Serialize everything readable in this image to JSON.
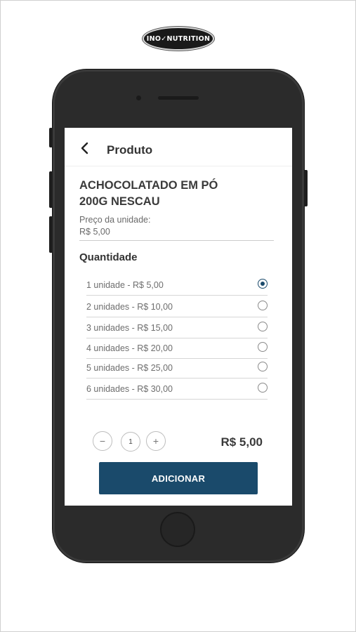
{
  "brand": {
    "logo_text": "INO✓NUTRITION"
  },
  "header": {
    "title": "Produto",
    "back_icon": "chevron-left-icon"
  },
  "product": {
    "name": "ACHOCOLATADO EM PÓ 200G NESCAU",
    "unit_price_label": "Preço da unidade:",
    "unit_price": "R$ 5,00"
  },
  "quantity": {
    "title": "Quantidade",
    "selected_index": 0,
    "options": [
      "1 unidade - R$ 5,00",
      "2 unidades - R$ 10,00",
      "3 unidades - R$ 15,00",
      "4 unidades - R$ 20,00",
      "5 unidades - R$ 25,00",
      "6 unidades - R$ 30,00"
    ]
  },
  "stepper": {
    "minus": "−",
    "value": "1",
    "plus": "+"
  },
  "total": "R$ 5,00",
  "add_button": "ADICIONAR",
  "colors": {
    "primary": "#1a4a6b",
    "phone_body": "#2b2b2b"
  }
}
